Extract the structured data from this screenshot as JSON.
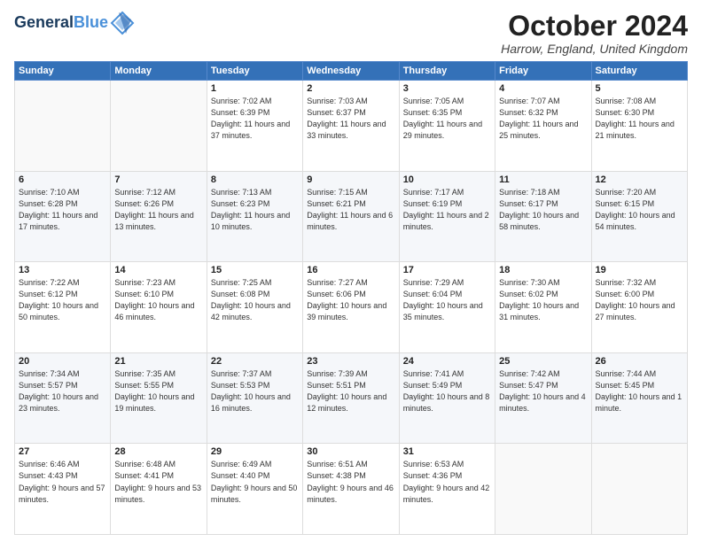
{
  "header": {
    "logo_line1": "General",
    "logo_line2": "Blue",
    "month_title": "October 2024",
    "location": "Harrow, England, United Kingdom"
  },
  "days_of_week": [
    "Sunday",
    "Monday",
    "Tuesday",
    "Wednesday",
    "Thursday",
    "Friday",
    "Saturday"
  ],
  "weeks": [
    [
      {
        "day": "",
        "info": ""
      },
      {
        "day": "",
        "info": ""
      },
      {
        "day": "1",
        "info": "Sunrise: 7:02 AM\nSunset: 6:39 PM\nDaylight: 11 hours\nand 37 minutes."
      },
      {
        "day": "2",
        "info": "Sunrise: 7:03 AM\nSunset: 6:37 PM\nDaylight: 11 hours\nand 33 minutes."
      },
      {
        "day": "3",
        "info": "Sunrise: 7:05 AM\nSunset: 6:35 PM\nDaylight: 11 hours\nand 29 minutes."
      },
      {
        "day": "4",
        "info": "Sunrise: 7:07 AM\nSunset: 6:32 PM\nDaylight: 11 hours\nand 25 minutes."
      },
      {
        "day": "5",
        "info": "Sunrise: 7:08 AM\nSunset: 6:30 PM\nDaylight: 11 hours\nand 21 minutes."
      }
    ],
    [
      {
        "day": "6",
        "info": "Sunrise: 7:10 AM\nSunset: 6:28 PM\nDaylight: 11 hours\nand 17 minutes."
      },
      {
        "day": "7",
        "info": "Sunrise: 7:12 AM\nSunset: 6:26 PM\nDaylight: 11 hours\nand 13 minutes."
      },
      {
        "day": "8",
        "info": "Sunrise: 7:13 AM\nSunset: 6:23 PM\nDaylight: 11 hours\nand 10 minutes."
      },
      {
        "day": "9",
        "info": "Sunrise: 7:15 AM\nSunset: 6:21 PM\nDaylight: 11 hours\nand 6 minutes."
      },
      {
        "day": "10",
        "info": "Sunrise: 7:17 AM\nSunset: 6:19 PM\nDaylight: 11 hours\nand 2 minutes."
      },
      {
        "day": "11",
        "info": "Sunrise: 7:18 AM\nSunset: 6:17 PM\nDaylight: 10 hours\nand 58 minutes."
      },
      {
        "day": "12",
        "info": "Sunrise: 7:20 AM\nSunset: 6:15 PM\nDaylight: 10 hours\nand 54 minutes."
      }
    ],
    [
      {
        "day": "13",
        "info": "Sunrise: 7:22 AM\nSunset: 6:12 PM\nDaylight: 10 hours\nand 50 minutes."
      },
      {
        "day": "14",
        "info": "Sunrise: 7:23 AM\nSunset: 6:10 PM\nDaylight: 10 hours\nand 46 minutes."
      },
      {
        "day": "15",
        "info": "Sunrise: 7:25 AM\nSunset: 6:08 PM\nDaylight: 10 hours\nand 42 minutes."
      },
      {
        "day": "16",
        "info": "Sunrise: 7:27 AM\nSunset: 6:06 PM\nDaylight: 10 hours\nand 39 minutes."
      },
      {
        "day": "17",
        "info": "Sunrise: 7:29 AM\nSunset: 6:04 PM\nDaylight: 10 hours\nand 35 minutes."
      },
      {
        "day": "18",
        "info": "Sunrise: 7:30 AM\nSunset: 6:02 PM\nDaylight: 10 hours\nand 31 minutes."
      },
      {
        "day": "19",
        "info": "Sunrise: 7:32 AM\nSunset: 6:00 PM\nDaylight: 10 hours\nand 27 minutes."
      }
    ],
    [
      {
        "day": "20",
        "info": "Sunrise: 7:34 AM\nSunset: 5:57 PM\nDaylight: 10 hours\nand 23 minutes."
      },
      {
        "day": "21",
        "info": "Sunrise: 7:35 AM\nSunset: 5:55 PM\nDaylight: 10 hours\nand 19 minutes."
      },
      {
        "day": "22",
        "info": "Sunrise: 7:37 AM\nSunset: 5:53 PM\nDaylight: 10 hours\nand 16 minutes."
      },
      {
        "day": "23",
        "info": "Sunrise: 7:39 AM\nSunset: 5:51 PM\nDaylight: 10 hours\nand 12 minutes."
      },
      {
        "day": "24",
        "info": "Sunrise: 7:41 AM\nSunset: 5:49 PM\nDaylight: 10 hours\nand 8 minutes."
      },
      {
        "day": "25",
        "info": "Sunrise: 7:42 AM\nSunset: 5:47 PM\nDaylight: 10 hours\nand 4 minutes."
      },
      {
        "day": "26",
        "info": "Sunrise: 7:44 AM\nSunset: 5:45 PM\nDaylight: 10 hours\nand 1 minute."
      }
    ],
    [
      {
        "day": "27",
        "info": "Sunrise: 6:46 AM\nSunset: 4:43 PM\nDaylight: 9 hours\nand 57 minutes."
      },
      {
        "day": "28",
        "info": "Sunrise: 6:48 AM\nSunset: 4:41 PM\nDaylight: 9 hours\nand 53 minutes."
      },
      {
        "day": "29",
        "info": "Sunrise: 6:49 AM\nSunset: 4:40 PM\nDaylight: 9 hours\nand 50 minutes."
      },
      {
        "day": "30",
        "info": "Sunrise: 6:51 AM\nSunset: 4:38 PM\nDaylight: 9 hours\nand 46 minutes."
      },
      {
        "day": "31",
        "info": "Sunrise: 6:53 AM\nSunset: 4:36 PM\nDaylight: 9 hours\nand 42 minutes."
      },
      {
        "day": "",
        "info": ""
      },
      {
        "day": "",
        "info": ""
      }
    ]
  ]
}
